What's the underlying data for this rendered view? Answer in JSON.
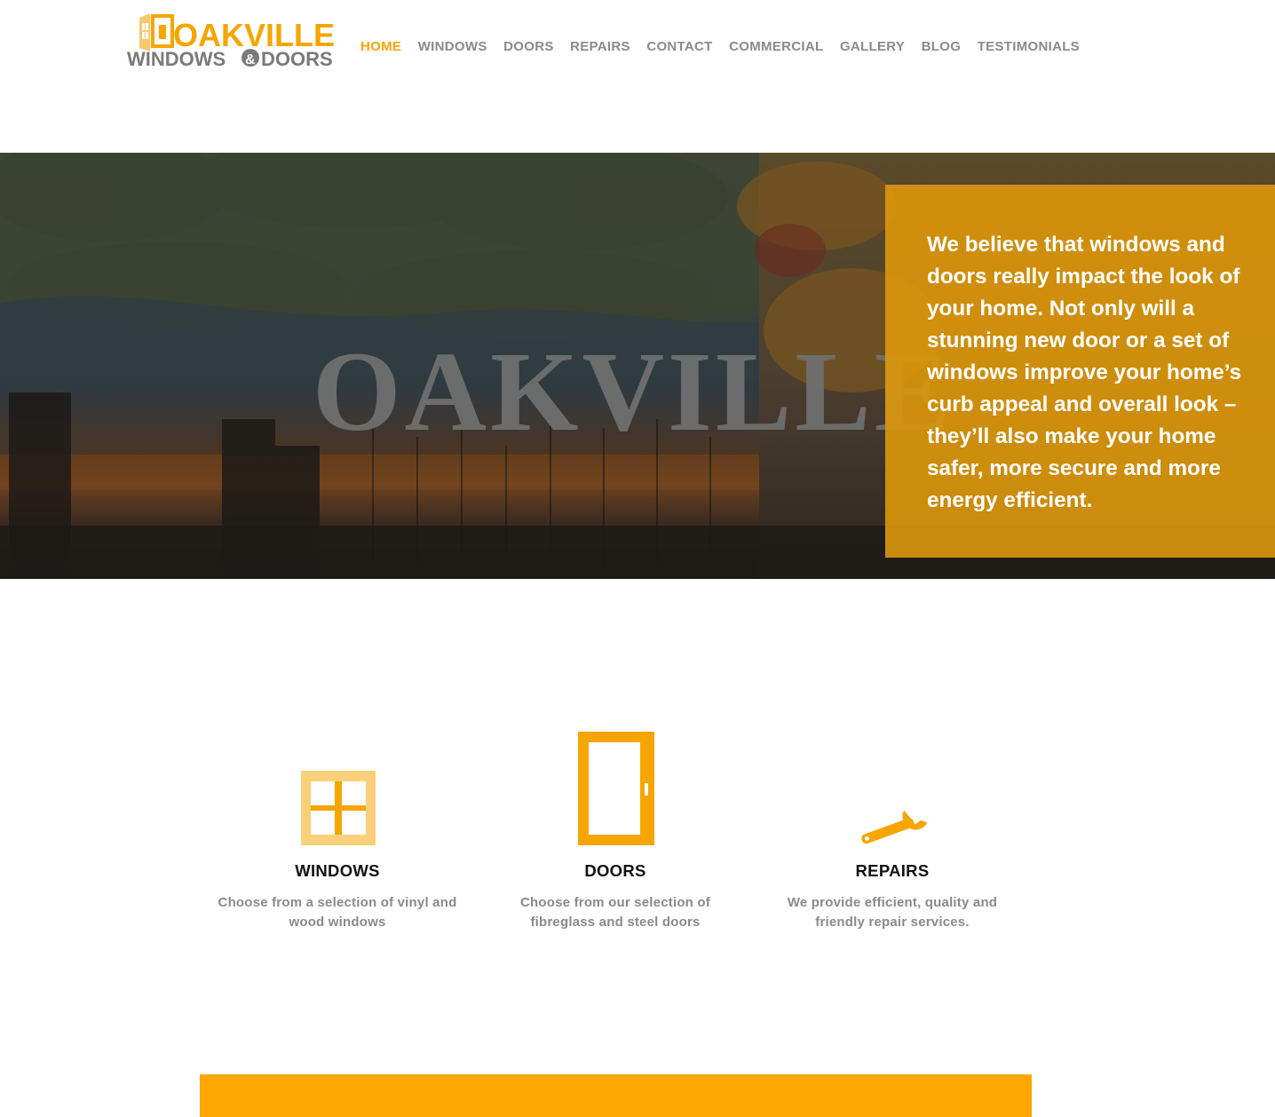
{
  "brand": {
    "name_top": "OAKVILLE",
    "name_bottom_left": "WINDOWS",
    "ampersand": "&",
    "name_bottom_right": "DOORS",
    "colors": {
      "accent": "#f7a501",
      "gray": "#7a7a7a"
    }
  },
  "nav": {
    "items": [
      {
        "label": "HOME",
        "active": true
      },
      {
        "label": "WINDOWS",
        "active": false
      },
      {
        "label": "DOORS",
        "active": false
      },
      {
        "label": "REPAIRS",
        "active": false
      },
      {
        "label": "CONTACT",
        "active": false
      },
      {
        "label": "COMMERCIAL",
        "active": false
      },
      {
        "label": "GALLERY",
        "active": false
      },
      {
        "label": "BLOG",
        "active": false
      },
      {
        "label": "TESTIMONIALS",
        "active": false
      }
    ]
  },
  "hero": {
    "city_sign": "OAKVILLE",
    "message": "We believe that windows and doors really impact the look of your home. Not only will a stunning new door or a set of windows improve your home’s curb appeal and overall look – they’ll also make your home safer, more secure and more energy efficient."
  },
  "services": [
    {
      "icon": "window-icon",
      "title": "WINDOWS",
      "description": "Choose from a selection of vinyl and wood windows"
    },
    {
      "icon": "door-icon",
      "title": "DOORS",
      "description": "Choose from our selection of fibreglass and steel doors"
    },
    {
      "icon": "wrench-icon",
      "title": "REPAIRS",
      "description": "We provide efficient, quality and friendly repair services."
    }
  ],
  "colors": {
    "accent": "#f7a501",
    "hero_overlay": "#dd970a",
    "band": "#fda700",
    "muted_text": "#8a8a8a"
  }
}
